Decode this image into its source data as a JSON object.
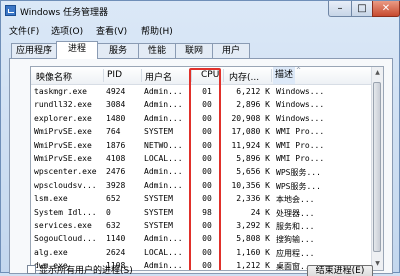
{
  "window": {
    "title": "Windows 任务管理器",
    "minimize_glyph": "–",
    "maximize_glyph": "□",
    "close_glyph": "✕",
    "icon": "task-manager-icon"
  },
  "menu": {
    "items": [
      "文件(F)",
      "选项(O)",
      "查看(V)",
      "帮助(H)"
    ]
  },
  "tabs": [
    {
      "label": "应用程序",
      "active": false
    },
    {
      "label": "进程",
      "active": true
    },
    {
      "label": "服务",
      "active": false
    },
    {
      "label": "性能",
      "active": false
    },
    {
      "label": "联网",
      "active": false
    },
    {
      "label": "用户",
      "active": false
    }
  ],
  "table": {
    "columns": {
      "name": "映像名称",
      "pid": "PID",
      "user": "用户名",
      "cpu": "CPU",
      "mem": "内存(...",
      "desc": "描述"
    },
    "sort_indicator": "^",
    "rows": [
      {
        "name": "taskmgr.exe",
        "pid": "4924",
        "user": "Admin...",
        "cpu": "01",
        "mem": "6,212 K",
        "desc": "Windows..."
      },
      {
        "name": "rundll32.exe",
        "pid": "3084",
        "user": "Admin...",
        "cpu": "00",
        "mem": "2,896 K",
        "desc": "Windows..."
      },
      {
        "name": "explorer.exe",
        "pid": "1480",
        "user": "Admin...",
        "cpu": "00",
        "mem": "20,908 K",
        "desc": "Windows..."
      },
      {
        "name": "WmiPrvSE.exe",
        "pid": "764",
        "user": "SYSTEM",
        "cpu": "00",
        "mem": "17,080 K",
        "desc": "WMI Pro..."
      },
      {
        "name": "WmiPrvSE.exe",
        "pid": "1876",
        "user": "NETWO...",
        "cpu": "00",
        "mem": "11,924 K",
        "desc": "WMI Pro..."
      },
      {
        "name": "WmiPrvSE.exe",
        "pid": "4108",
        "user": "LOCAL...",
        "cpu": "00",
        "mem": "5,896 K",
        "desc": "WMI Pro..."
      },
      {
        "name": "wpscenter.exe",
        "pid": "2476",
        "user": "Admin...",
        "cpu": "00",
        "mem": "5,656 K",
        "desc": "WPS服务..."
      },
      {
        "name": "wpscloudsv...",
        "pid": "3928",
        "user": "Admin...",
        "cpu": "00",
        "mem": "10,356 K",
        "desc": "WPS服务..."
      },
      {
        "name": "lsm.exe",
        "pid": "652",
        "user": "SYSTEM",
        "cpu": "00",
        "mem": "2,336 K",
        "desc": "本地会..."
      },
      {
        "name": "System Idl...",
        "pid": "0",
        "user": "SYSTEM",
        "cpu": "98",
        "mem": "24 K",
        "desc": "处理器..."
      },
      {
        "name": "services.exe",
        "pid": "632",
        "user": "SYSTEM",
        "cpu": "00",
        "mem": "3,292 K",
        "desc": "服务和..."
      },
      {
        "name": "SogouCloud...",
        "pid": "1140",
        "user": "Admin...",
        "cpu": "00",
        "mem": "5,808 K",
        "desc": "搜狗输..."
      },
      {
        "name": "alg.exe",
        "pid": "2624",
        "user": "LOCAL...",
        "cpu": "00",
        "mem": "1,160 K",
        "desc": "应用程..."
      },
      {
        "name": "dwm.exe",
        "pid": "1108",
        "user": "Admin...",
        "cpu": "00",
        "mem": "1,212 K",
        "desc": "桌面窗..."
      }
    ]
  },
  "scrollbar": {
    "up_glyph": "▲",
    "down_glyph": "▼"
  },
  "footer": {
    "show_all_label": "显示所有用户的进程(S)",
    "end_process_label": "结束进程(E)"
  },
  "colors": {
    "highlight_box": "#e0302a",
    "close_button": "#c74a2f"
  }
}
